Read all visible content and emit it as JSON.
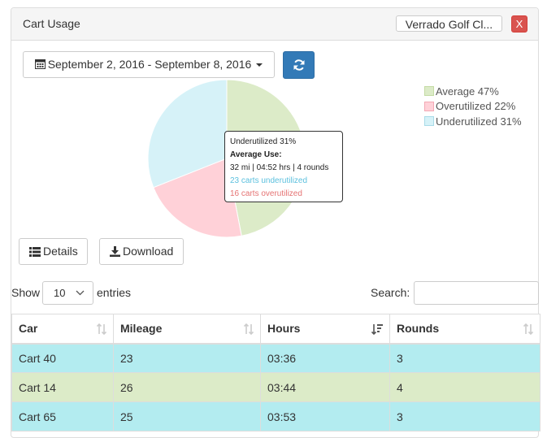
{
  "panel": {
    "title": "Cart Usage",
    "course_button": "Verrado Golf Cl...",
    "close_label": "X"
  },
  "date_range": {
    "label": "September 2, 2016 - September 8, 2016"
  },
  "legend": [
    {
      "label": "Average 47%",
      "color": "#dcebc8",
      "border": "#c4dba5"
    },
    {
      "label": "Overutilized 22%",
      "color": "#ffd1d8",
      "border": "#f3a9b5"
    },
    {
      "label": "Underutilized 31%",
      "color": "#d6f2f8",
      "border": "#a9dbe8"
    }
  ],
  "chart_data": {
    "type": "pie",
    "series": [
      {
        "name": "Average",
        "value": 47,
        "color": "#dcebc8"
      },
      {
        "name": "Overutilized",
        "value": 22,
        "color": "#ffd1d8"
      },
      {
        "name": "Underutilized",
        "value": 31,
        "color": "#d6f2f8"
      }
    ]
  },
  "tooltip": {
    "title": "Underutilized 31%",
    "subtitle": "Average Use:",
    "stats": "32 mi | 04:52 hrs | 4 rounds",
    "under": "23 carts underutilized",
    "over": "16 carts overutilized"
  },
  "actions": {
    "details": "Details",
    "download": "Download"
  },
  "table_controls": {
    "show": "Show",
    "entries_value": "10",
    "entries": "entries",
    "search": "Search:"
  },
  "table": {
    "headers": [
      "Car",
      "Mileage",
      "Hours",
      "Rounds"
    ],
    "rows": [
      {
        "car": "Cart 40",
        "mileage": "23",
        "hours": "03:36",
        "rounds": "3"
      },
      {
        "car": "Cart 14",
        "mileage": "26",
        "hours": "03:44",
        "rounds": "4"
      },
      {
        "car": "Cart 65",
        "mileage": "25",
        "hours": "03:53",
        "rounds": "3"
      }
    ]
  }
}
